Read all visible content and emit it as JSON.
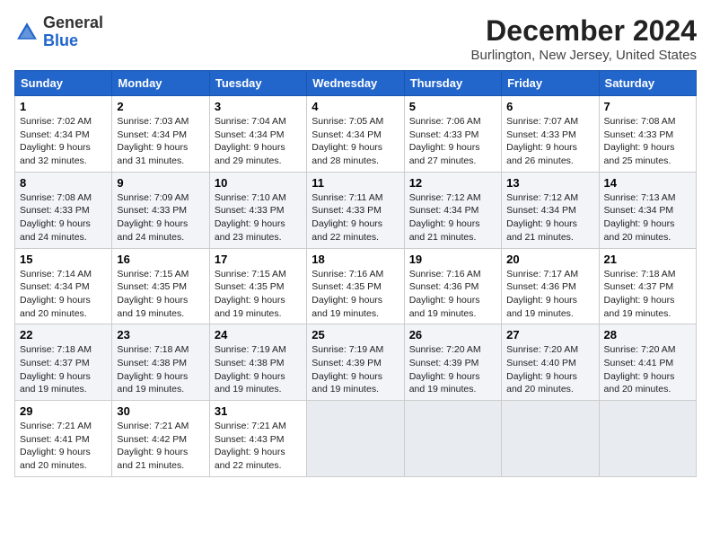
{
  "header": {
    "logo_general": "General",
    "logo_blue": "Blue",
    "month_title": "December 2024",
    "subtitle": "Burlington, New Jersey, United States"
  },
  "weekdays": [
    "Sunday",
    "Monday",
    "Tuesday",
    "Wednesday",
    "Thursday",
    "Friday",
    "Saturday"
  ],
  "weeks": [
    [
      {
        "day": "1",
        "sunrise": "Sunrise: 7:02 AM",
        "sunset": "Sunset: 4:34 PM",
        "daylight": "Daylight: 9 hours and 32 minutes."
      },
      {
        "day": "2",
        "sunrise": "Sunrise: 7:03 AM",
        "sunset": "Sunset: 4:34 PM",
        "daylight": "Daylight: 9 hours and 31 minutes."
      },
      {
        "day": "3",
        "sunrise": "Sunrise: 7:04 AM",
        "sunset": "Sunset: 4:34 PM",
        "daylight": "Daylight: 9 hours and 29 minutes."
      },
      {
        "day": "4",
        "sunrise": "Sunrise: 7:05 AM",
        "sunset": "Sunset: 4:34 PM",
        "daylight": "Daylight: 9 hours and 28 minutes."
      },
      {
        "day": "5",
        "sunrise": "Sunrise: 7:06 AM",
        "sunset": "Sunset: 4:33 PM",
        "daylight": "Daylight: 9 hours and 27 minutes."
      },
      {
        "day": "6",
        "sunrise": "Sunrise: 7:07 AM",
        "sunset": "Sunset: 4:33 PM",
        "daylight": "Daylight: 9 hours and 26 minutes."
      },
      {
        "day": "7",
        "sunrise": "Sunrise: 7:08 AM",
        "sunset": "Sunset: 4:33 PM",
        "daylight": "Daylight: 9 hours and 25 minutes."
      }
    ],
    [
      {
        "day": "8",
        "sunrise": "Sunrise: 7:08 AM",
        "sunset": "Sunset: 4:33 PM",
        "daylight": "Daylight: 9 hours and 24 minutes."
      },
      {
        "day": "9",
        "sunrise": "Sunrise: 7:09 AM",
        "sunset": "Sunset: 4:33 PM",
        "daylight": "Daylight: 9 hours and 24 minutes."
      },
      {
        "day": "10",
        "sunrise": "Sunrise: 7:10 AM",
        "sunset": "Sunset: 4:33 PM",
        "daylight": "Daylight: 9 hours and 23 minutes."
      },
      {
        "day": "11",
        "sunrise": "Sunrise: 7:11 AM",
        "sunset": "Sunset: 4:33 PM",
        "daylight": "Daylight: 9 hours and 22 minutes."
      },
      {
        "day": "12",
        "sunrise": "Sunrise: 7:12 AM",
        "sunset": "Sunset: 4:34 PM",
        "daylight": "Daylight: 9 hours and 21 minutes."
      },
      {
        "day": "13",
        "sunrise": "Sunrise: 7:12 AM",
        "sunset": "Sunset: 4:34 PM",
        "daylight": "Daylight: 9 hours and 21 minutes."
      },
      {
        "day": "14",
        "sunrise": "Sunrise: 7:13 AM",
        "sunset": "Sunset: 4:34 PM",
        "daylight": "Daylight: 9 hours and 20 minutes."
      }
    ],
    [
      {
        "day": "15",
        "sunrise": "Sunrise: 7:14 AM",
        "sunset": "Sunset: 4:34 PM",
        "daylight": "Daylight: 9 hours and 20 minutes."
      },
      {
        "day": "16",
        "sunrise": "Sunrise: 7:15 AM",
        "sunset": "Sunset: 4:35 PM",
        "daylight": "Daylight: 9 hours and 19 minutes."
      },
      {
        "day": "17",
        "sunrise": "Sunrise: 7:15 AM",
        "sunset": "Sunset: 4:35 PM",
        "daylight": "Daylight: 9 hours and 19 minutes."
      },
      {
        "day": "18",
        "sunrise": "Sunrise: 7:16 AM",
        "sunset": "Sunset: 4:35 PM",
        "daylight": "Daylight: 9 hours and 19 minutes."
      },
      {
        "day": "19",
        "sunrise": "Sunrise: 7:16 AM",
        "sunset": "Sunset: 4:36 PM",
        "daylight": "Daylight: 9 hours and 19 minutes."
      },
      {
        "day": "20",
        "sunrise": "Sunrise: 7:17 AM",
        "sunset": "Sunset: 4:36 PM",
        "daylight": "Daylight: 9 hours and 19 minutes."
      },
      {
        "day": "21",
        "sunrise": "Sunrise: 7:18 AM",
        "sunset": "Sunset: 4:37 PM",
        "daylight": "Daylight: 9 hours and 19 minutes."
      }
    ],
    [
      {
        "day": "22",
        "sunrise": "Sunrise: 7:18 AM",
        "sunset": "Sunset: 4:37 PM",
        "daylight": "Daylight: 9 hours and 19 minutes."
      },
      {
        "day": "23",
        "sunrise": "Sunrise: 7:18 AM",
        "sunset": "Sunset: 4:38 PM",
        "daylight": "Daylight: 9 hours and 19 minutes."
      },
      {
        "day": "24",
        "sunrise": "Sunrise: 7:19 AM",
        "sunset": "Sunset: 4:38 PM",
        "daylight": "Daylight: 9 hours and 19 minutes."
      },
      {
        "day": "25",
        "sunrise": "Sunrise: 7:19 AM",
        "sunset": "Sunset: 4:39 PM",
        "daylight": "Daylight: 9 hours and 19 minutes."
      },
      {
        "day": "26",
        "sunrise": "Sunrise: 7:20 AM",
        "sunset": "Sunset: 4:39 PM",
        "daylight": "Daylight: 9 hours and 19 minutes."
      },
      {
        "day": "27",
        "sunrise": "Sunrise: 7:20 AM",
        "sunset": "Sunset: 4:40 PM",
        "daylight": "Daylight: 9 hours and 20 minutes."
      },
      {
        "day": "28",
        "sunrise": "Sunrise: 7:20 AM",
        "sunset": "Sunset: 4:41 PM",
        "daylight": "Daylight: 9 hours and 20 minutes."
      }
    ],
    [
      {
        "day": "29",
        "sunrise": "Sunrise: 7:21 AM",
        "sunset": "Sunset: 4:41 PM",
        "daylight": "Daylight: 9 hours and 20 minutes."
      },
      {
        "day": "30",
        "sunrise": "Sunrise: 7:21 AM",
        "sunset": "Sunset: 4:42 PM",
        "daylight": "Daylight: 9 hours and 21 minutes."
      },
      {
        "day": "31",
        "sunrise": "Sunrise: 7:21 AM",
        "sunset": "Sunset: 4:43 PM",
        "daylight": "Daylight: 9 hours and 22 minutes."
      },
      null,
      null,
      null,
      null
    ]
  ]
}
